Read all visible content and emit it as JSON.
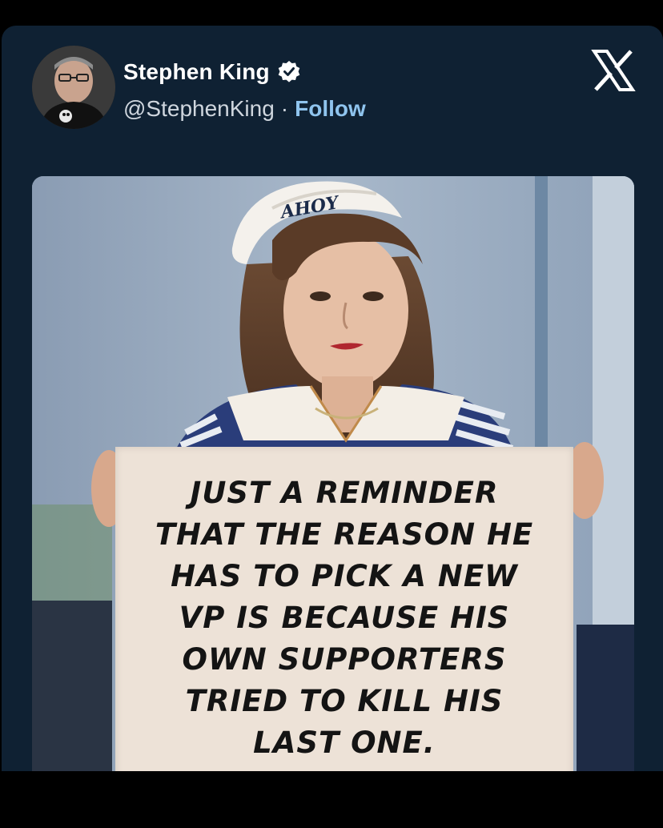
{
  "post": {
    "author": {
      "display_name": "Stephen King",
      "handle": "@StephenKing",
      "separator": "·",
      "follow_label": "Follow",
      "verified": true,
      "avatar_icon": "author-avatar"
    },
    "platform_icon": "x-logo-icon",
    "media": {
      "hat_text": "AHOY",
      "sign_lines": [
        "JUST A REMINDER",
        "THAT THE REASON HE",
        "HAS TO PICK A NEW",
        "VP IS BECAUSE HIS",
        "OWN SUPPORTERS",
        "TRIED TO KILL HIS",
        "LAST ONE."
      ]
    }
  },
  "colors": {
    "page_background": "#000000",
    "card_background": "#0f2133",
    "follow_link": "#8fc4ee",
    "verified_badge": "#ffffff"
  }
}
